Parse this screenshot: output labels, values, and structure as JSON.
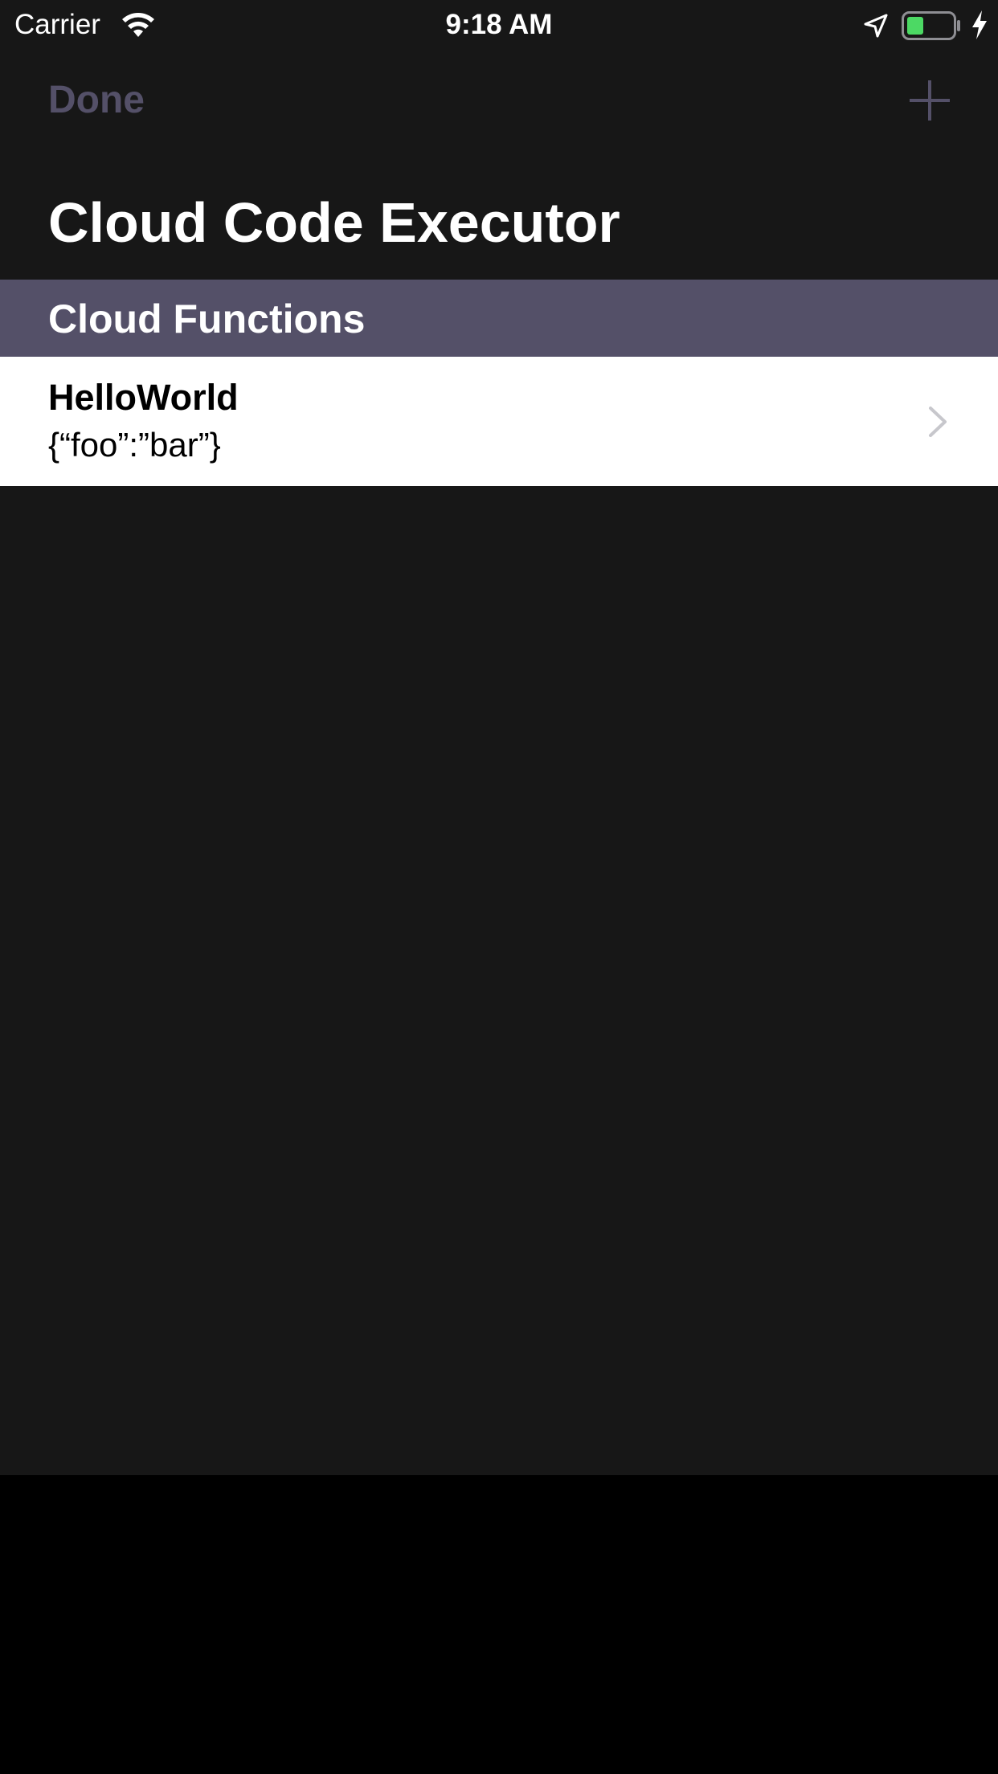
{
  "status_bar": {
    "carrier": "Carrier",
    "time": "9:18 AM",
    "icons": [
      "wifi-icon",
      "location-arrow-icon",
      "battery-icon",
      "charging-bolt-icon"
    ],
    "battery_color": "#4cd964"
  },
  "nav": {
    "done_label": "Done",
    "add_icon": "plus-icon",
    "title": "Cloud Code Executor"
  },
  "section": {
    "title": "Cloud Functions",
    "items": [
      {
        "name": "HelloWorld",
        "params": "{“foo”:”bar”}",
        "accessory": "chevron-right-icon"
      }
    ]
  },
  "colors": {
    "accent": "#545068",
    "background": "#171717",
    "row_background": "#ffffff"
  }
}
